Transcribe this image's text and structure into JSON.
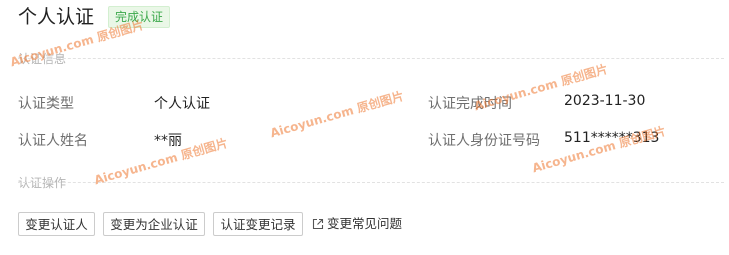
{
  "header": {
    "title": "个人认证",
    "status_badge": "完成认证"
  },
  "sections": {
    "info_title": "认证信息",
    "actions_title": "认证操作"
  },
  "info": {
    "type_label": "认证类型",
    "type_value": "个人认证",
    "name_label": "认证人姓名",
    "name_value": "**丽",
    "time_label": "认证完成时间",
    "time_value": "2023-11-30",
    "id_label": "认证人身份证号码",
    "id_value": "511******313"
  },
  "actions": {
    "change_person": "变更认证人",
    "change_to_enterprise": "变更为企业认证",
    "change_log": "认证变更记录",
    "faq": "变更常见问题"
  },
  "watermark": "Aicoyun.com 原创图片",
  "colors": {
    "badge_text": "#3aa84a",
    "badge_bg": "#eaf7e7",
    "watermark": "#ee7832"
  }
}
